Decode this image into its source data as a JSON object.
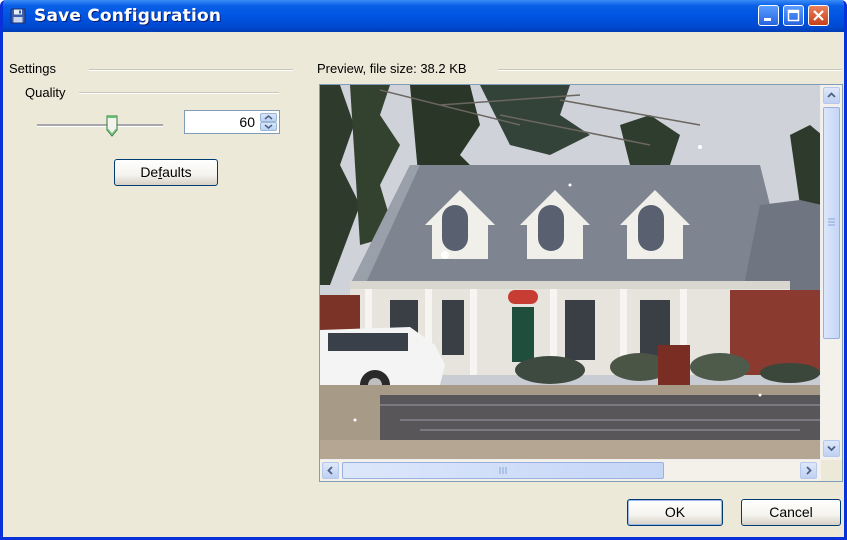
{
  "window": {
    "title": "Save Configuration",
    "controls": [
      "minimize",
      "maximize",
      "close"
    ]
  },
  "settings": {
    "group_label": "Settings",
    "quality_label": "Quality",
    "quality_value": "60",
    "quality_slider_fraction": 0.6,
    "defaults_label_before": "De",
    "defaults_label_mnemonic": "f",
    "defaults_label_after": "aults"
  },
  "preview": {
    "label": "Preview, file size: 38.2 KB",
    "image": "house-photo"
  },
  "dialog_buttons": {
    "ok": "OK",
    "cancel": "Cancel"
  },
  "colors": {
    "titlebar": "#0054e3",
    "window_bg": "#ece9d8",
    "close_button": "#c5401a"
  }
}
